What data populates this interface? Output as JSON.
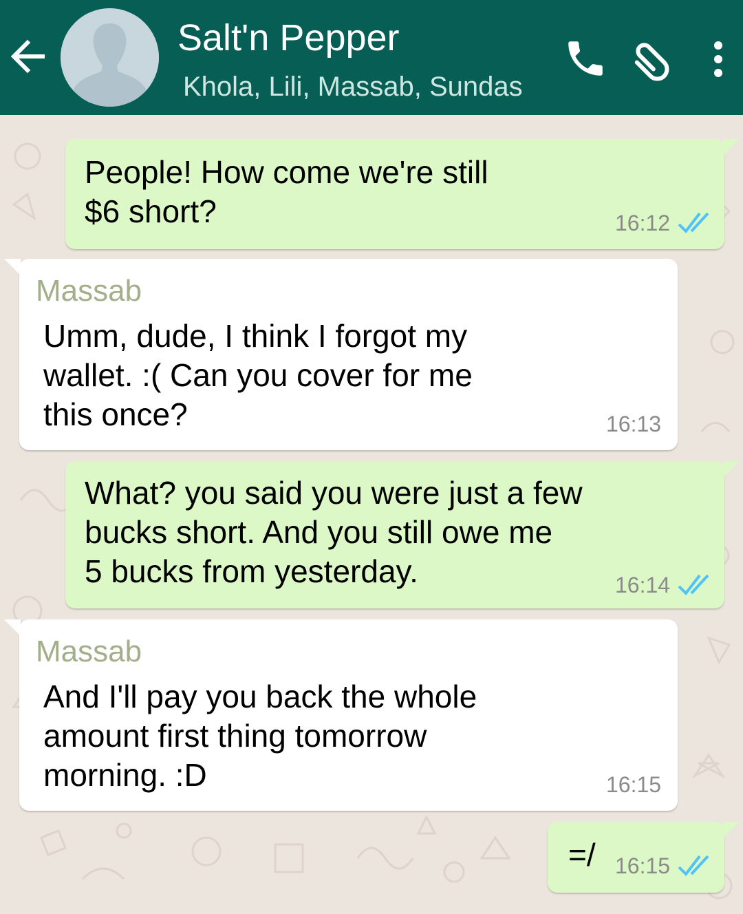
{
  "header": {
    "title": "Salt'n Pepper",
    "members": "Khola, Lili, Massab, Sundas",
    "color": "#075e54",
    "icons": [
      "back-arrow-icon",
      "group-avatar",
      "phone-icon",
      "paperclip-icon",
      "more-vert-icon"
    ]
  },
  "messages": [
    {
      "direction": "outgoing",
      "text": "People! How come we're still\n$6 short?",
      "time": "16:12",
      "status": "read"
    },
    {
      "direction": "incoming",
      "sender": "Massab",
      "text": "Umm, dude, I think I forgot my\nwallet. :( Can you cover for me\nthis once?",
      "time": "16:13"
    },
    {
      "direction": "outgoing",
      "text": "What? you said you were just a few\nbucks short. And you still owe me\n5 bucks from yesterday.",
      "time": "16:14",
      "status": "read"
    },
    {
      "direction": "incoming",
      "sender": "Massab",
      "text": "And I'll pay you back the whole\namount first thing tomorrow\nmorning. :D",
      "time": "16:15"
    },
    {
      "direction": "outgoing",
      "text": "=/",
      "time": "16:15",
      "status": "read"
    }
  ],
  "colors": {
    "outgoing_bubble": "#dcf8c6",
    "incoming_bubble": "#ffffff",
    "sender_name": "#a3ae8a",
    "read_ticks": "#4fc3f7",
    "chat_background": "#ece5dd"
  }
}
